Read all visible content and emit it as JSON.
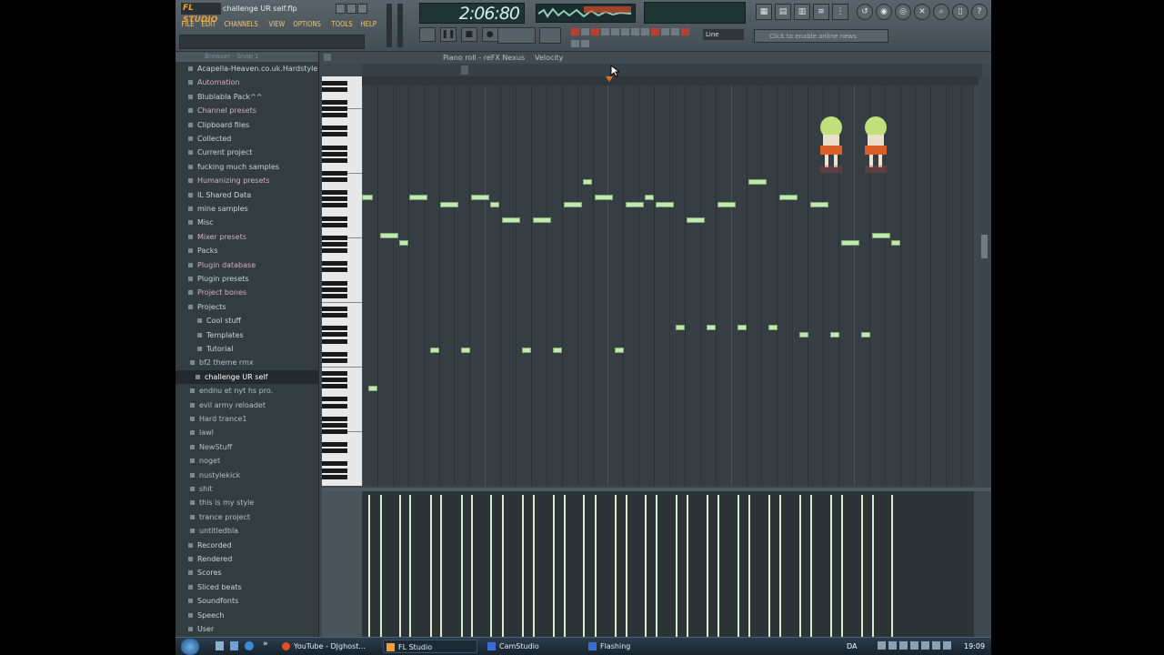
{
  "app": {
    "logo": "FL STUDIO",
    "filename": "challenge UR self.flp",
    "time": "2:06:80",
    "news": "Click to enable online news",
    "line_mode": "Line"
  },
  "menu": [
    "FILE",
    "EDIT",
    "CHANNELS",
    "VIEW",
    "OPTIONS",
    "TOOLS",
    "HELP"
  ],
  "browser": {
    "title": "Browser - Snap 1",
    "items": [
      {
        "label": "Acapella-Heaven.co.uk.Hardstyle",
        "kind": "folder"
      },
      {
        "label": "Automation",
        "kind": "folder"
      },
      {
        "label": "Blublabla Pack^^",
        "kind": "folder"
      },
      {
        "label": "Channel presets",
        "kind": "folder"
      },
      {
        "label": "Clipboard files",
        "kind": "folder"
      },
      {
        "label": "Collected",
        "kind": "folder"
      },
      {
        "label": "Current project",
        "kind": "folder"
      },
      {
        "label": "fucking much samples",
        "kind": "folder"
      },
      {
        "label": "Humanizing presets",
        "kind": "folder"
      },
      {
        "label": "IL Shared Data",
        "kind": "folder"
      },
      {
        "label": "mine samples",
        "kind": "folder"
      },
      {
        "label": "Misc",
        "kind": "folder"
      },
      {
        "label": "Mixer presets",
        "kind": "folder"
      },
      {
        "label": "Packs",
        "kind": "folder"
      },
      {
        "label": "Plugin database",
        "kind": "folder"
      },
      {
        "label": "Plugin presets",
        "kind": "folder"
      },
      {
        "label": "Project bones",
        "kind": "folder"
      },
      {
        "label": "Projects",
        "kind": "open-folder"
      },
      {
        "label": "Cool stuff",
        "kind": "subfolder"
      },
      {
        "label": "Templates",
        "kind": "subfolder"
      },
      {
        "label": "Tutorial",
        "kind": "subfolder"
      },
      {
        "label": "bf2 theme rmx",
        "kind": "file"
      },
      {
        "label": "challenge UR self",
        "kind": "file-selected"
      },
      {
        "label": "endnu et nyt hs pro.",
        "kind": "file"
      },
      {
        "label": "evil army reloadet",
        "kind": "file"
      },
      {
        "label": "Hard trance1",
        "kind": "file"
      },
      {
        "label": "lawl",
        "kind": "file"
      },
      {
        "label": "NewStuff",
        "kind": "file"
      },
      {
        "label": "noget",
        "kind": "file"
      },
      {
        "label": "nustylekick",
        "kind": "file"
      },
      {
        "label": "shit",
        "kind": "file"
      },
      {
        "label": "this is my style",
        "kind": "file"
      },
      {
        "label": "trance project",
        "kind": "file"
      },
      {
        "label": "untitledbla",
        "kind": "file"
      },
      {
        "label": "Recorded",
        "kind": "folder"
      },
      {
        "label": "Rendered",
        "kind": "folder"
      },
      {
        "label": "Scores",
        "kind": "folder"
      },
      {
        "label": "Sliced beats",
        "kind": "folder"
      },
      {
        "label": "Soundfonts",
        "kind": "folder"
      },
      {
        "label": "Speech",
        "kind": "folder"
      },
      {
        "label": "User",
        "kind": "folder"
      }
    ]
  },
  "piano_roll": {
    "title": "Piano roll - reFX Nexus",
    "target": "Velocity"
  },
  "taskbar": {
    "items": [
      "YouTube - DJghost...",
      "FL Studio",
      "CamStudio",
      "Flashing"
    ],
    "lang": "DA",
    "clock": "19:09"
  }
}
